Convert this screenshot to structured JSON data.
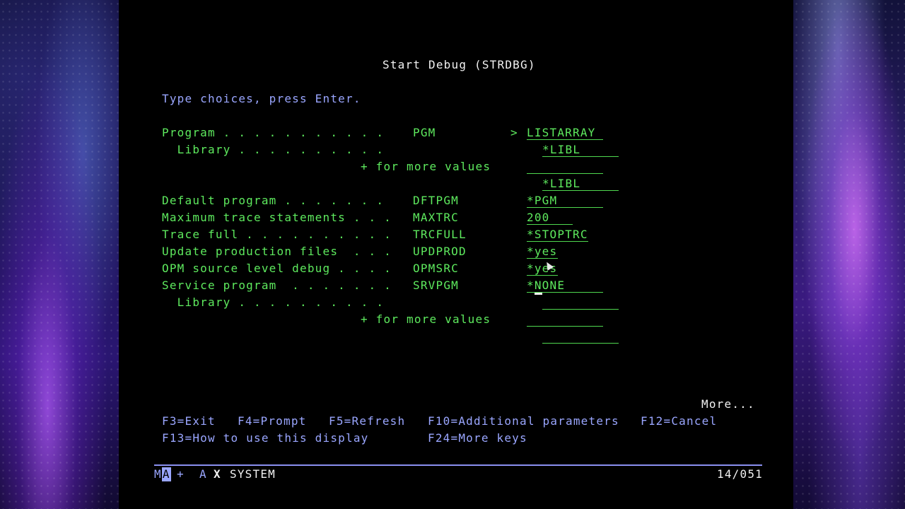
{
  "screen": {
    "title": "Start Debug (STRDBG)",
    "instruction": "Type choices, press Enter.",
    "parameters": [
      {
        "label": "Program . . . . . . . . . . .",
        "keyword": "PGM",
        "marker": ">",
        "value": "LISTARRAY"
      },
      {
        "label": "  Library . . . . . . . . . .",
        "keyword": "",
        "marker": "",
        "value": "*LIBL"
      },
      {
        "label": "+ for more values",
        "keyword": "",
        "marker": "",
        "value": ""
      },
      {
        "label": "",
        "keyword": "",
        "marker": "",
        "value": "*LIBL"
      },
      {
        "label": "Default program . . . . . . .",
        "keyword": "DFTPGM",
        "marker": "",
        "value": "*PGM"
      },
      {
        "label": "Maximum trace statements . . .",
        "keyword": "MAXTRC",
        "marker": "",
        "value": "200"
      },
      {
        "label": "Trace full . . . . . . . . . .",
        "keyword": "TRCFULL",
        "marker": "",
        "value": "*STOPTRC"
      },
      {
        "label": "Update production files  . . .",
        "keyword": "UPDPROD",
        "marker": "",
        "value": "*yes"
      },
      {
        "label": "OPM source level debug . . . .",
        "keyword": "OPMSRC",
        "marker": "",
        "value": "*yes"
      },
      {
        "label": "Service program  . . . . . . .",
        "keyword": "SRVPGM",
        "marker": "",
        "value": "*NONE"
      },
      {
        "label": "  Library . . . . . . . . . .",
        "keyword": "",
        "marker": "",
        "value": ""
      },
      {
        "label": "+ for more values",
        "keyword": "",
        "marker": "",
        "value": ""
      }
    ],
    "more": "More...",
    "function_keys": {
      "f3": "F3=Exit",
      "f4": "F4=Prompt",
      "f5": "F5=Refresh",
      "f10": "F10=Additional parameters",
      "f12": "F12=Cancel",
      "f13": "F13=How to use this display",
      "f24": "F24=More keys"
    },
    "status": {
      "ma_left": "M",
      "ma_box": "A",
      "plus": "+",
      "a": "A",
      "x": "X",
      "system": "SYSTEM",
      "position": "14/051"
    }
  },
  "colors": {
    "screen_bg": "#000000",
    "field_text": "#5eea5e",
    "prompt_text": "#9aa6ff",
    "title_text": "#f2f2f2"
  }
}
